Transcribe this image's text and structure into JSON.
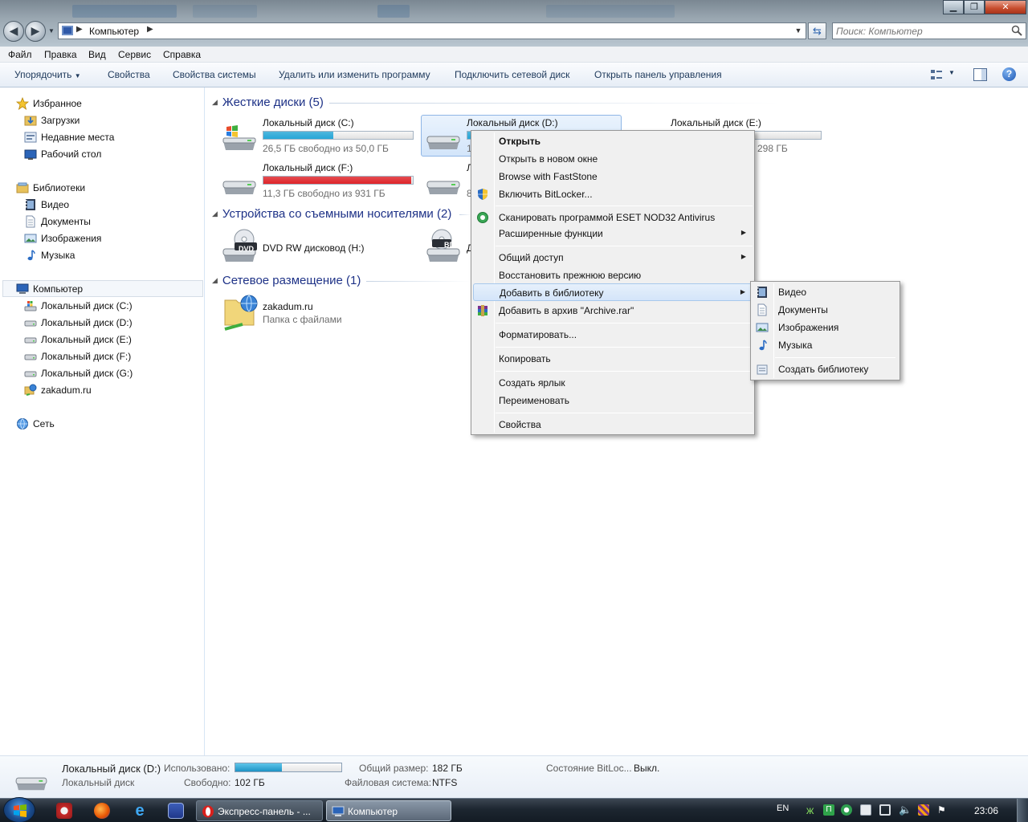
{
  "window": {
    "address_path": "Компьютер",
    "search_placeholder": "Поиск: Компьютер"
  },
  "menubar": [
    "Файл",
    "Правка",
    "Вид",
    "Сервис",
    "Справка"
  ],
  "toolbar": {
    "organize": "Упорядочить",
    "commands": [
      "Свойства",
      "Свойства системы",
      "Удалить или изменить программу",
      "Подключить сетевой диск",
      "Открыть панель управления"
    ]
  },
  "nav": {
    "favorites": "Избранное",
    "favorites_items": [
      "Загрузки",
      "Недавние места",
      "Рабочий стол"
    ],
    "libraries": "Библиотеки",
    "library_items": [
      "Видео",
      "Документы",
      "Изображения",
      "Музыка"
    ],
    "computer": "Компьютер",
    "computer_items": [
      "Локальный диск (C:)",
      "Локальный диск (D:)",
      "Локальный диск (E:)",
      "Локальный диск (F:)",
      "Локальный диск (G:)",
      "zakadum.ru"
    ],
    "network": "Сеть"
  },
  "groups": {
    "hard_disks": "Жесткие диски (5)",
    "removable": "Устройства со съемными носителями (2)",
    "network": "Сетевое размещение (1)"
  },
  "drives": [
    {
      "name": "Локальный диск (C:)",
      "free": "26,5 ГБ свободно из 50,0 ГБ",
      "used_fraction": 0.47,
      "color": "#27a7d8"
    },
    {
      "name": "Локальный диск (D:)",
      "free": "1",
      "used_fraction": 0.44,
      "color": "#27a7d8"
    },
    {
      "name": "Локальный диск (E:)",
      "free": "298 ГБ",
      "used_fraction": 0.0,
      "color": "#27a7d8"
    },
    {
      "name": "Локальный диск (F:)",
      "free": "11,3 ГБ свободно из 931 ГБ",
      "used_fraction": 0.99,
      "color": "#e0242a"
    },
    {
      "name": "Л",
      "free": "8",
      "used_fraction": 0.3,
      "color": "#27a7d8"
    }
  ],
  "removable": [
    {
      "name": "DVD RW дисковод (H:)",
      "badge": "DVD"
    },
    {
      "name": "Д",
      "badge": "BD"
    }
  ],
  "network_items": [
    {
      "name": "zakadum.ru",
      "sub": "Папка с файлами"
    }
  ],
  "context_menu": {
    "open": "Открыть",
    "open_new_window": "Открыть в новом окне",
    "browse_faststone": "Browse with FastStone",
    "bitlocker": "Включить BitLocker...",
    "eset_scan": "Сканировать программой ESET NOD32 Antivirus",
    "advanced": "Расширенные функции",
    "sharing": "Общий доступ",
    "restore": "Восстановить прежнюю версию",
    "add_library": "Добавить в библиотеку",
    "add_archive": "Добавить в архив \"Archive.rar\"",
    "format": "Форматировать...",
    "copy": "Копировать",
    "shortcut": "Создать ярлык",
    "rename": "Переименовать",
    "properties": "Свойства"
  },
  "submenu": {
    "video": "Видео",
    "documents": "Документы",
    "images": "Изображения",
    "music": "Музыка",
    "create_library": "Создать библиотеку"
  },
  "details": {
    "name": "Локальный диск (D:)",
    "type": "Локальный диск",
    "used_label": "Использовано:",
    "used_fraction": 0.44,
    "free_label": "Свободно:",
    "free_value": "102 ГБ",
    "total_label": "Общий размер:",
    "total_value": "182 ГБ",
    "fs_label": "Файловая система:",
    "fs_value": "NTFS",
    "bitlocker_label": "Состояние BitLoc...",
    "bitlocker_value": "Выкл."
  },
  "taskbar": {
    "tasks": [
      "Экспресс-панель - ...",
      "Компьютер"
    ],
    "lang": "EN",
    "time": "23:06"
  }
}
